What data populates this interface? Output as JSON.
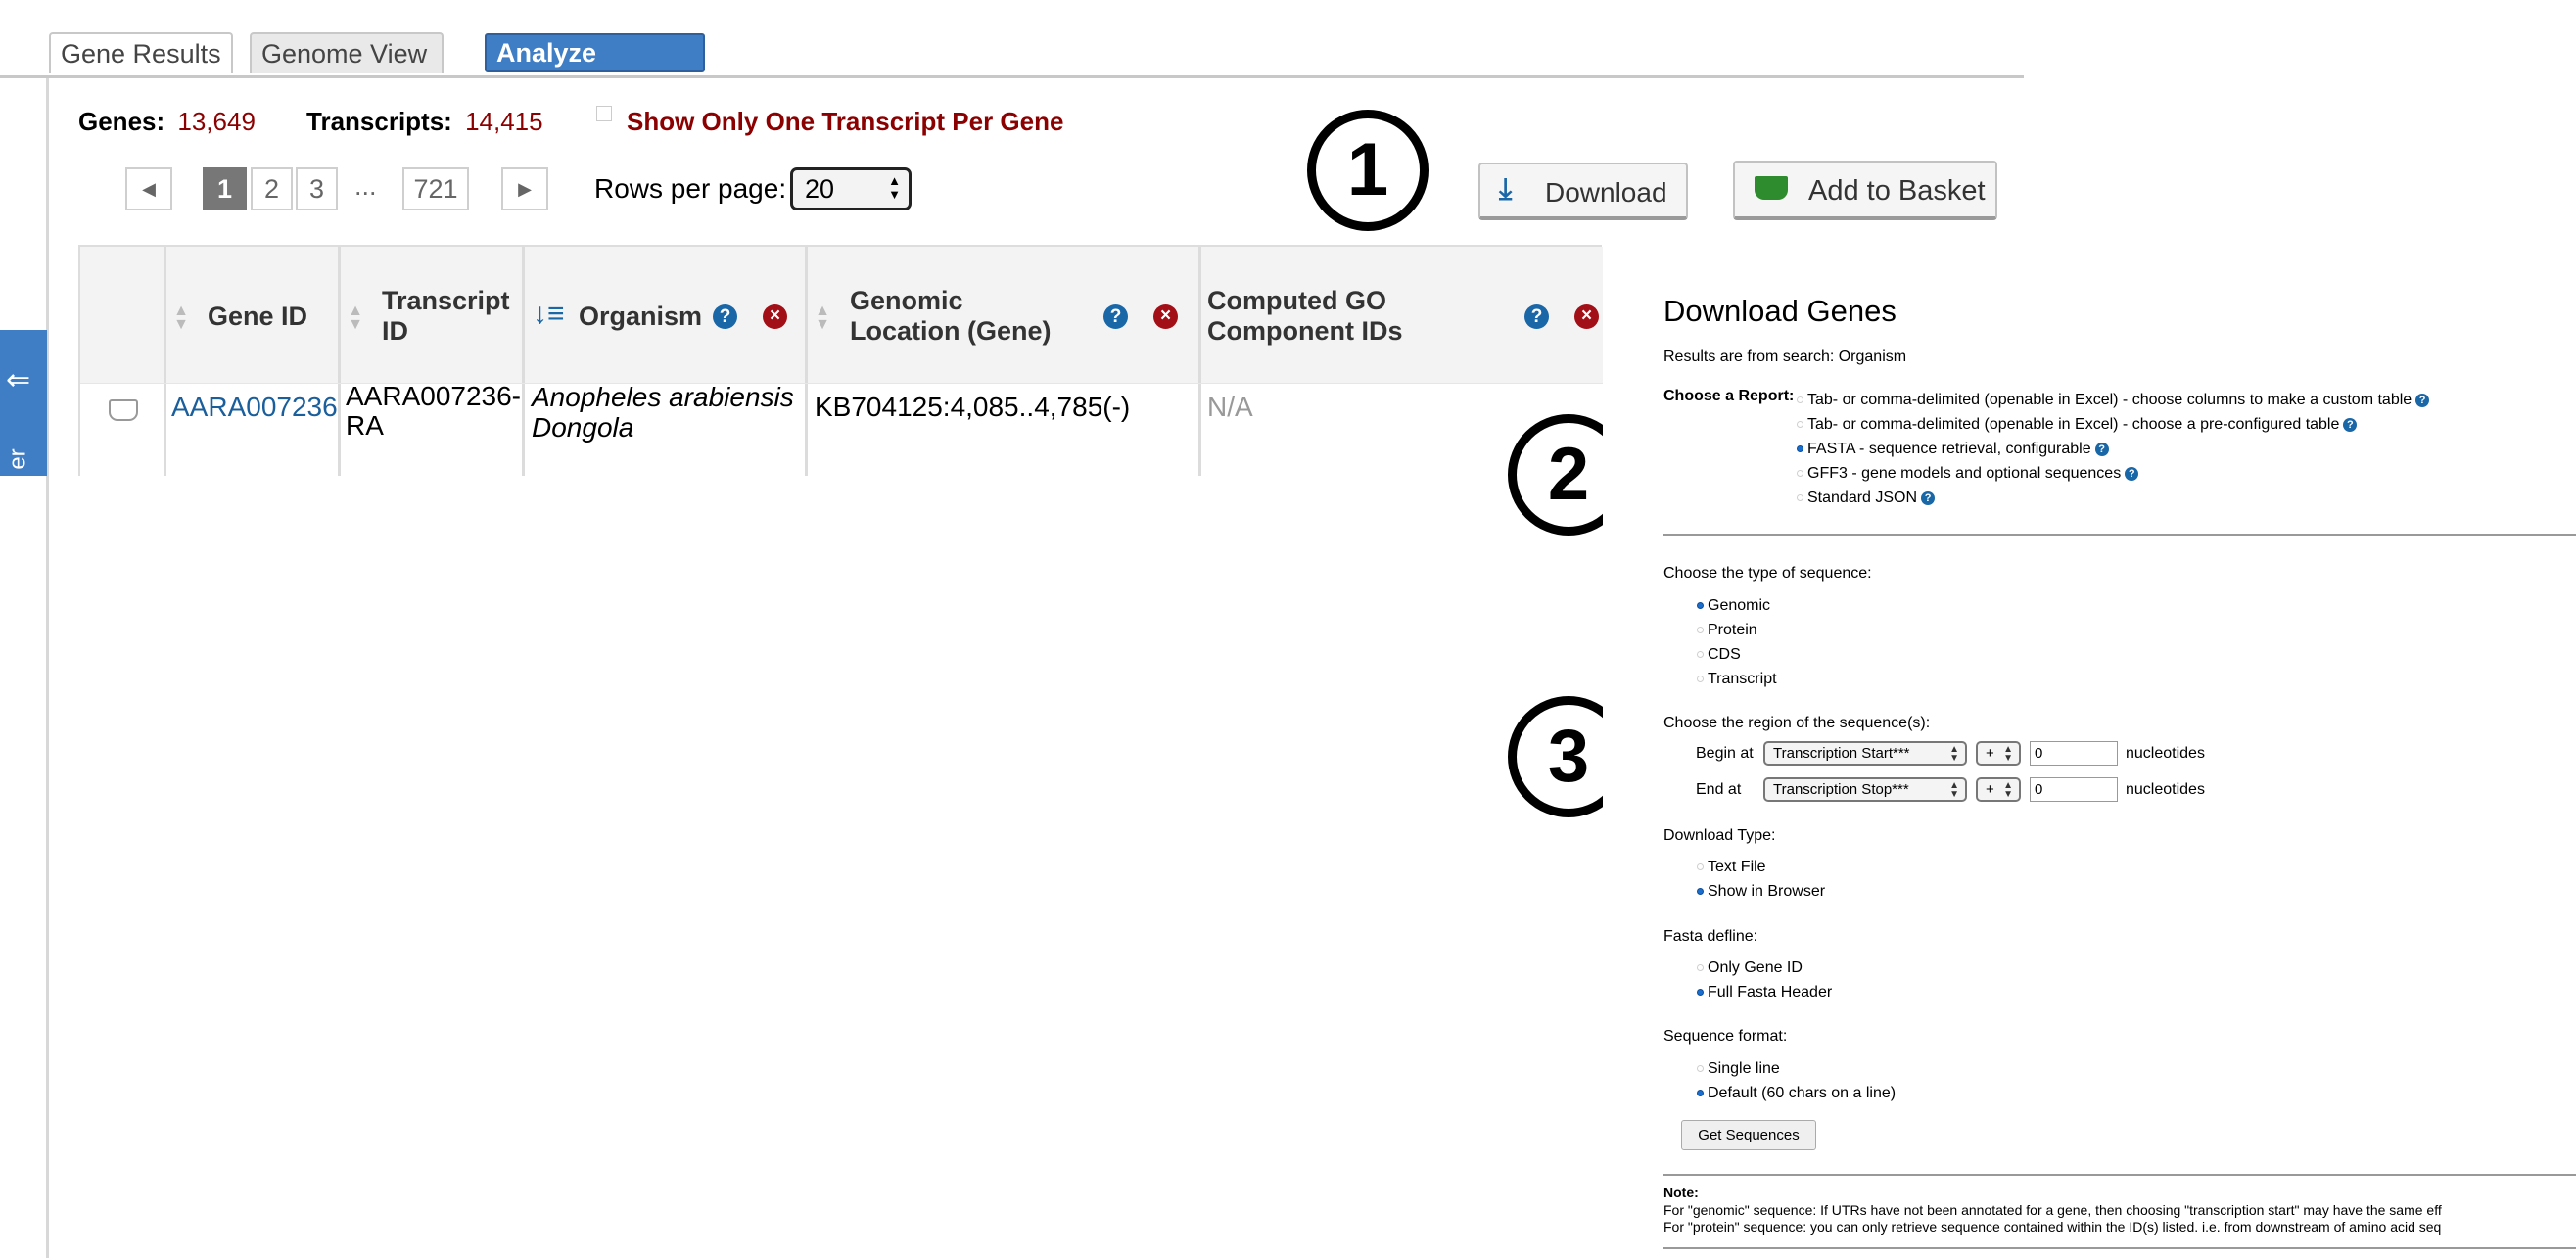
{
  "tabs": {
    "gene_results": "Gene Results",
    "genome_view": "Genome View",
    "analyze_results": "Analyze Results"
  },
  "summary": {
    "genes_label": "Genes:",
    "genes_value": "13,649",
    "transcripts_label": "Transcripts:",
    "transcripts_value": "14,415",
    "one_transcript_label": "Show Only One Transcript Per Gene"
  },
  "pager": {
    "pages": [
      "1",
      "2",
      "3"
    ],
    "ellipsis": "...",
    "last_page": "721",
    "rows_label": "Rows per page:",
    "rows_value": "20"
  },
  "actions": {
    "download": "Download",
    "add_to_basket": "Add to Basket"
  },
  "table": {
    "columns": [
      "Gene ID",
      "Transcript ID",
      "Organism",
      "Genomic Location (Gene)",
      "Computed GO Component IDs"
    ],
    "row": {
      "gene_id": "AARA007236",
      "transcript_id": "AARA007236-RA",
      "organism": "Anopheles arabiensis Dongola",
      "location": "KB704125:4,085..4,785(-)",
      "go_ids": "N/A"
    }
  },
  "side_tab": {
    "text": "er"
  },
  "callouts": [
    "1",
    "2",
    "3"
  ],
  "download_form": {
    "title": "Download Genes",
    "subtitle": "Results are from search: Organism",
    "report_label": "Choose a Report:",
    "reports": [
      {
        "label": "Tab- or comma-delimited (openable in Excel) - choose columns to make a custom table",
        "selected": false
      },
      {
        "label": "Tab- or comma-delimited (openable in Excel) - choose a pre-configured table",
        "selected": false
      },
      {
        "label": "FASTA - sequence retrieval, configurable",
        "selected": true
      },
      {
        "label": "GFF3 - gene models and optional sequences",
        "selected": false
      },
      {
        "label": "Standard JSON",
        "selected": false
      }
    ],
    "seq_type_label": "Choose the type of sequence:",
    "seq_types": [
      {
        "label": "Genomic",
        "selected": true
      },
      {
        "label": "Protein",
        "selected": false
      },
      {
        "label": "CDS",
        "selected": false
      },
      {
        "label": "Transcript",
        "selected": false
      }
    ],
    "region_label": "Choose the region of the sequence(s):",
    "begin_label": "Begin at",
    "begin_anchor": "Transcription Start***",
    "begin_sign": "+",
    "begin_offset": "0",
    "end_label": "End at",
    "end_anchor": "Transcription Stop***",
    "end_sign": "+",
    "end_offset": "0",
    "unit": "nucleotides",
    "download_type_label": "Download Type:",
    "download_types": [
      {
        "label": "Text File",
        "selected": false
      },
      {
        "label": "Show in Browser",
        "selected": true
      }
    ],
    "defline_label": "Fasta defline:",
    "deflines": [
      {
        "label": "Only Gene ID",
        "selected": false
      },
      {
        "label": "Full Fasta Header",
        "selected": true
      }
    ],
    "format_label": "Sequence format:",
    "formats": [
      {
        "label": "Single line",
        "selected": false
      },
      {
        "label": "Default (60 chars on a line)",
        "selected": true
      }
    ],
    "submit": "Get Sequences",
    "note_label": "Note:",
    "note_lines": [
      "For \"genomic\" sequence: If UTRs have not been annotated for a gene, then choosing \"transcription start\" may have the same eff",
      "For \"protein\" sequence: you can only retrieve sequence contained within the ID(s) listed. i.e. from downstream of amino acid seq"
    ]
  }
}
